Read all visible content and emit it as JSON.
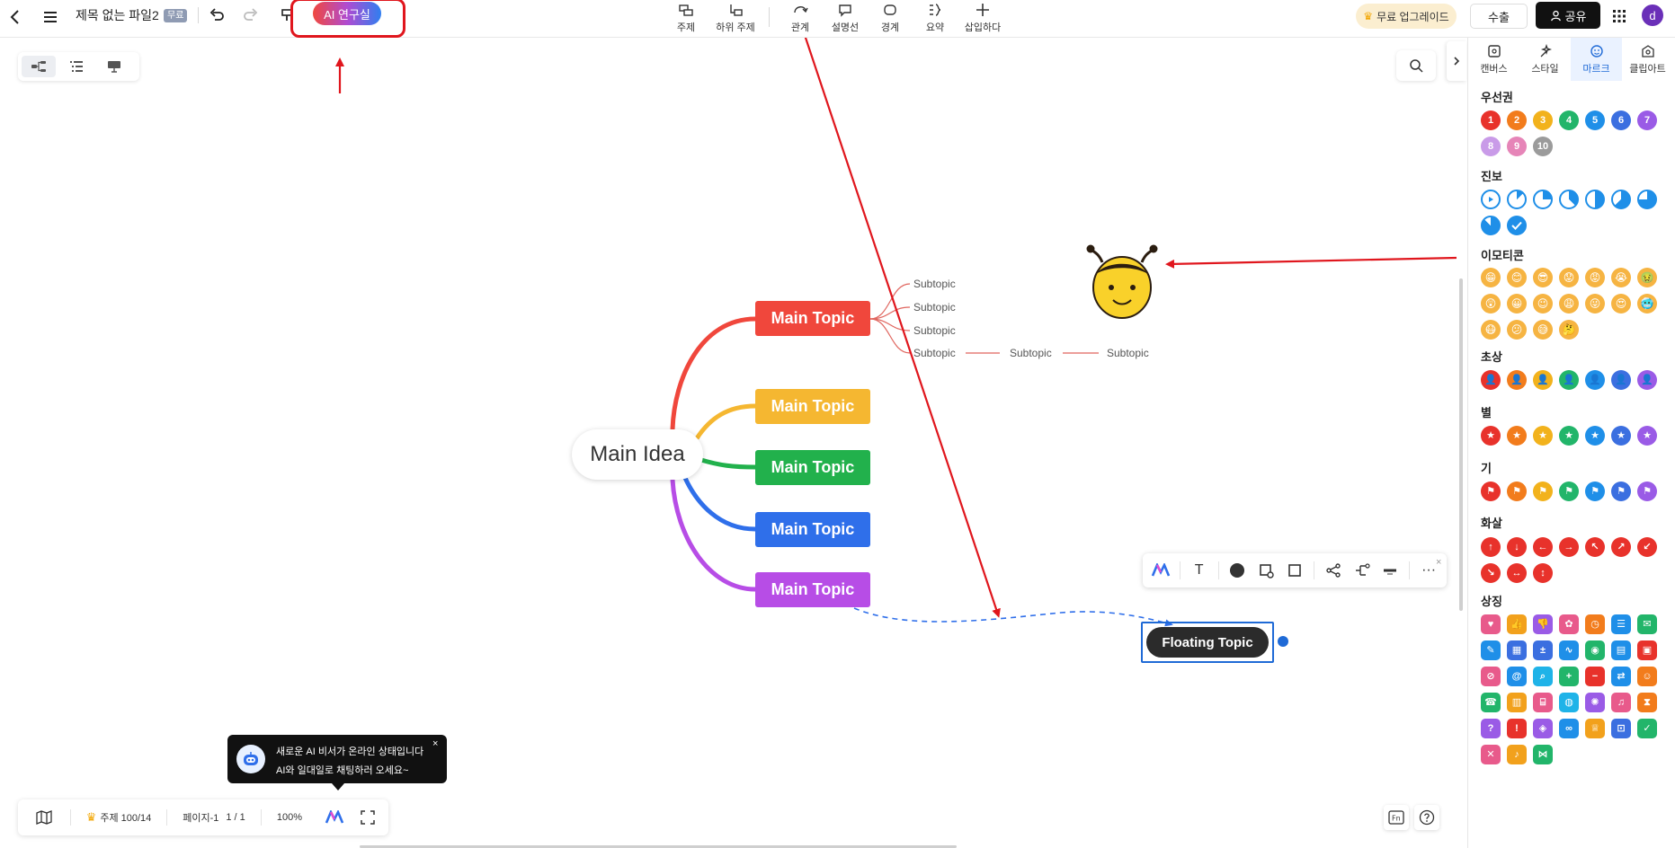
{
  "topbar": {
    "file_title": "제목 없는 파일2",
    "free_badge": "무료",
    "ai_button": "AI 연구실",
    "tools": [
      {
        "label": "주제",
        "icon": "topic-icon"
      },
      {
        "label": "하위 주제",
        "icon": "subtopic-icon"
      },
      {
        "label": "관계",
        "icon": "relation-icon"
      },
      {
        "label": "설명선",
        "icon": "callout-icon"
      },
      {
        "label": "경계",
        "icon": "boundary-icon"
      },
      {
        "label": "요약",
        "icon": "summary-icon"
      },
      {
        "label": "삽입하다",
        "icon": "insert-icon"
      }
    ],
    "upgrade_button": "무료 업그레이드",
    "export_button": "수출",
    "share_button": "공유",
    "avatar_letter": "d"
  },
  "mindmap": {
    "main_idea": "Main Idea",
    "main_topics": [
      {
        "label": "Main Topic",
        "color": "#f0473c"
      },
      {
        "label": "Main Topic",
        "color": "#f5b731"
      },
      {
        "label": "Main Topic",
        "color": "#22b14c"
      },
      {
        "label": "Main Topic",
        "color": "#2f6fea"
      },
      {
        "label": "Main Topic",
        "color": "#b74de6"
      }
    ],
    "subtopics": [
      "Subtopic",
      "Subtopic",
      "Subtopic",
      "Subtopic",
      "Subtopic",
      "Subtopic"
    ],
    "floating_topic": "Floating Topic"
  },
  "ai_tip": {
    "line1": "새로운 AI 비서가 온라인 상태입니다",
    "line2": "AI와 일대일로 채팅하러 오세요~",
    "close": "×"
  },
  "bottombar": {
    "topic_count": "주제 100/14",
    "page_label": "페이지-1",
    "page_count": "1 / 1",
    "zoom": "100%"
  },
  "float_toolbar": {
    "text_icon": "T",
    "more_icon": "···",
    "close": "×"
  },
  "right_panel": {
    "tabs": [
      {
        "label": "캔버스",
        "icon": "canvas-icon",
        "active": false
      },
      {
        "label": "스타일",
        "icon": "style-icon",
        "active": false
      },
      {
        "label": "마르크",
        "icon": "mark-icon",
        "active": true
      },
      {
        "label": "클립아트",
        "icon": "clipart-icon",
        "active": false
      }
    ],
    "sections": {
      "priority": "우선권",
      "progress": "진보",
      "emoji": "이모티콘",
      "portrait": "초상",
      "star": "별",
      "flag": "기",
      "arrow": "화살",
      "symbol": "상징"
    },
    "priority_numbers": [
      "1",
      "2",
      "3",
      "4",
      "5",
      "6",
      "7",
      "8",
      "9",
      "10"
    ]
  },
  "colors": {
    "accent_blue": "#1f6ad6",
    "annotation_red": "#e0161d"
  }
}
